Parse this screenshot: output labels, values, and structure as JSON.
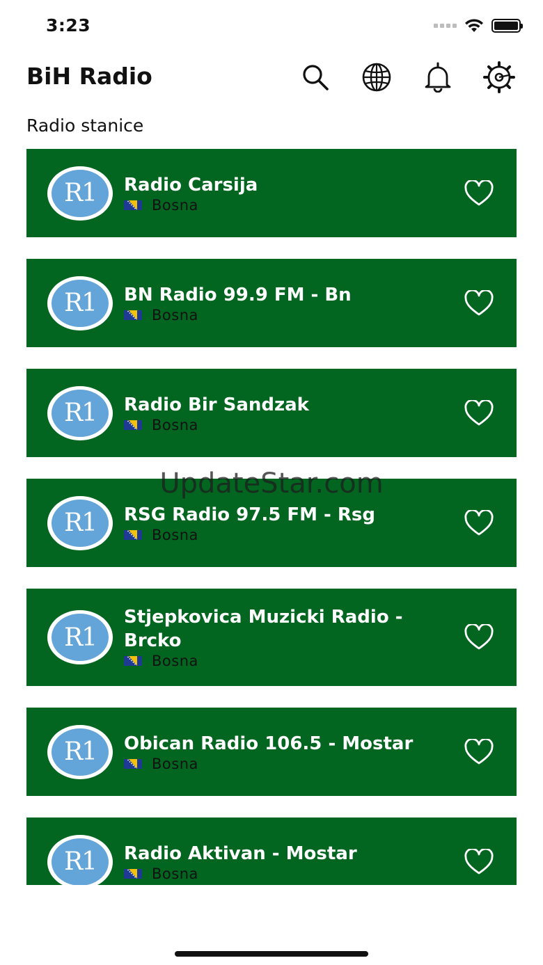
{
  "status_bar": {
    "time": "3:23"
  },
  "header": {
    "title": "BiH Radio",
    "actions": [
      {
        "name": "search",
        "icon": "search-icon"
      },
      {
        "name": "globe",
        "icon": "globe-icon"
      },
      {
        "name": "notifications",
        "icon": "bell-icon"
      },
      {
        "name": "settings",
        "icon": "gear-icon"
      }
    ]
  },
  "section": {
    "title": "Radio stanice"
  },
  "colors": {
    "card_background": "#036620",
    "logo_blue": "#63a4d9"
  },
  "stations": [
    {
      "name": "Radio Carsija",
      "country": "Bosna",
      "logo_text": "R1"
    },
    {
      "name": "BN Radio 99.9 FM - Bn",
      "country": "Bosna",
      "logo_text": "R1"
    },
    {
      "name": "Radio Bir Sandzak",
      "country": "Bosna",
      "logo_text": "R1"
    },
    {
      "name": "RSG Radio 97.5 FM - Rsg",
      "country": "Bosna",
      "logo_text": "R1"
    },
    {
      "name": "Stjepkovica Muzicki Radio - Brcko",
      "country": "Bosna",
      "logo_text": "R1"
    },
    {
      "name": "Obican Radio 106.5 - Mostar",
      "country": "Bosna",
      "logo_text": "R1"
    },
    {
      "name": "Radio Aktivan - Mostar",
      "country": "Bosna",
      "logo_text": "R1"
    }
  ],
  "watermark": "UpdateStar.com"
}
